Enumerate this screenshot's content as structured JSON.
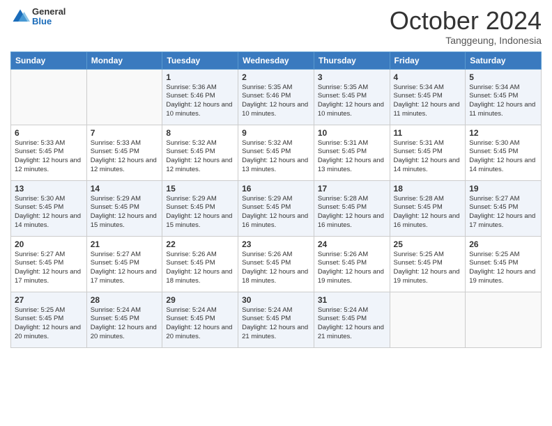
{
  "logo": {
    "general": "General",
    "blue": "Blue"
  },
  "header": {
    "month": "October 2024",
    "location": "Tanggeung, Indonesia"
  },
  "weekdays": [
    "Sunday",
    "Monday",
    "Tuesday",
    "Wednesday",
    "Thursday",
    "Friday",
    "Saturday"
  ],
  "weeks": [
    [
      {
        "day": "",
        "sunrise": "",
        "sunset": "",
        "daylight": ""
      },
      {
        "day": "",
        "sunrise": "",
        "sunset": "",
        "daylight": ""
      },
      {
        "day": "1",
        "sunrise": "Sunrise: 5:36 AM",
        "sunset": "Sunset: 5:46 PM",
        "daylight": "Daylight: 12 hours and 10 minutes."
      },
      {
        "day": "2",
        "sunrise": "Sunrise: 5:35 AM",
        "sunset": "Sunset: 5:46 PM",
        "daylight": "Daylight: 12 hours and 10 minutes."
      },
      {
        "day": "3",
        "sunrise": "Sunrise: 5:35 AM",
        "sunset": "Sunset: 5:45 PM",
        "daylight": "Daylight: 12 hours and 10 minutes."
      },
      {
        "day": "4",
        "sunrise": "Sunrise: 5:34 AM",
        "sunset": "Sunset: 5:45 PM",
        "daylight": "Daylight: 12 hours and 11 minutes."
      },
      {
        "day": "5",
        "sunrise": "Sunrise: 5:34 AM",
        "sunset": "Sunset: 5:45 PM",
        "daylight": "Daylight: 12 hours and 11 minutes."
      }
    ],
    [
      {
        "day": "6",
        "sunrise": "Sunrise: 5:33 AM",
        "sunset": "Sunset: 5:45 PM",
        "daylight": "Daylight: 12 hours and 12 minutes."
      },
      {
        "day": "7",
        "sunrise": "Sunrise: 5:33 AM",
        "sunset": "Sunset: 5:45 PM",
        "daylight": "Daylight: 12 hours and 12 minutes."
      },
      {
        "day": "8",
        "sunrise": "Sunrise: 5:32 AM",
        "sunset": "Sunset: 5:45 PM",
        "daylight": "Daylight: 12 hours and 12 minutes."
      },
      {
        "day": "9",
        "sunrise": "Sunrise: 5:32 AM",
        "sunset": "Sunset: 5:45 PM",
        "daylight": "Daylight: 12 hours and 13 minutes."
      },
      {
        "day": "10",
        "sunrise": "Sunrise: 5:31 AM",
        "sunset": "Sunset: 5:45 PM",
        "daylight": "Daylight: 12 hours and 13 minutes."
      },
      {
        "day": "11",
        "sunrise": "Sunrise: 5:31 AM",
        "sunset": "Sunset: 5:45 PM",
        "daylight": "Daylight: 12 hours and 14 minutes."
      },
      {
        "day": "12",
        "sunrise": "Sunrise: 5:30 AM",
        "sunset": "Sunset: 5:45 PM",
        "daylight": "Daylight: 12 hours and 14 minutes."
      }
    ],
    [
      {
        "day": "13",
        "sunrise": "Sunrise: 5:30 AM",
        "sunset": "Sunset: 5:45 PM",
        "daylight": "Daylight: 12 hours and 14 minutes."
      },
      {
        "day": "14",
        "sunrise": "Sunrise: 5:29 AM",
        "sunset": "Sunset: 5:45 PM",
        "daylight": "Daylight: 12 hours and 15 minutes."
      },
      {
        "day": "15",
        "sunrise": "Sunrise: 5:29 AM",
        "sunset": "Sunset: 5:45 PM",
        "daylight": "Daylight: 12 hours and 15 minutes."
      },
      {
        "day": "16",
        "sunrise": "Sunrise: 5:29 AM",
        "sunset": "Sunset: 5:45 PM",
        "daylight": "Daylight: 12 hours and 16 minutes."
      },
      {
        "day": "17",
        "sunrise": "Sunrise: 5:28 AM",
        "sunset": "Sunset: 5:45 PM",
        "daylight": "Daylight: 12 hours and 16 minutes."
      },
      {
        "day": "18",
        "sunrise": "Sunrise: 5:28 AM",
        "sunset": "Sunset: 5:45 PM",
        "daylight": "Daylight: 12 hours and 16 minutes."
      },
      {
        "day": "19",
        "sunrise": "Sunrise: 5:27 AM",
        "sunset": "Sunset: 5:45 PM",
        "daylight": "Daylight: 12 hours and 17 minutes."
      }
    ],
    [
      {
        "day": "20",
        "sunrise": "Sunrise: 5:27 AM",
        "sunset": "Sunset: 5:45 PM",
        "daylight": "Daylight: 12 hours and 17 minutes."
      },
      {
        "day": "21",
        "sunrise": "Sunrise: 5:27 AM",
        "sunset": "Sunset: 5:45 PM",
        "daylight": "Daylight: 12 hours and 17 minutes."
      },
      {
        "day": "22",
        "sunrise": "Sunrise: 5:26 AM",
        "sunset": "Sunset: 5:45 PM",
        "daylight": "Daylight: 12 hours and 18 minutes."
      },
      {
        "day": "23",
        "sunrise": "Sunrise: 5:26 AM",
        "sunset": "Sunset: 5:45 PM",
        "daylight": "Daylight: 12 hours and 18 minutes."
      },
      {
        "day": "24",
        "sunrise": "Sunrise: 5:26 AM",
        "sunset": "Sunset: 5:45 PM",
        "daylight": "Daylight: 12 hours and 19 minutes."
      },
      {
        "day": "25",
        "sunrise": "Sunrise: 5:25 AM",
        "sunset": "Sunset: 5:45 PM",
        "daylight": "Daylight: 12 hours and 19 minutes."
      },
      {
        "day": "26",
        "sunrise": "Sunrise: 5:25 AM",
        "sunset": "Sunset: 5:45 PM",
        "daylight": "Daylight: 12 hours and 19 minutes."
      }
    ],
    [
      {
        "day": "27",
        "sunrise": "Sunrise: 5:25 AM",
        "sunset": "Sunset: 5:45 PM",
        "daylight": "Daylight: 12 hours and 20 minutes."
      },
      {
        "day": "28",
        "sunrise": "Sunrise: 5:24 AM",
        "sunset": "Sunset: 5:45 PM",
        "daylight": "Daylight: 12 hours and 20 minutes."
      },
      {
        "day": "29",
        "sunrise": "Sunrise: 5:24 AM",
        "sunset": "Sunset: 5:45 PM",
        "daylight": "Daylight: 12 hours and 20 minutes."
      },
      {
        "day": "30",
        "sunrise": "Sunrise: 5:24 AM",
        "sunset": "Sunset: 5:45 PM",
        "daylight": "Daylight: 12 hours and 21 minutes."
      },
      {
        "day": "31",
        "sunrise": "Sunrise: 5:24 AM",
        "sunset": "Sunset: 5:45 PM",
        "daylight": "Daylight: 12 hours and 21 minutes."
      },
      {
        "day": "",
        "sunrise": "",
        "sunset": "",
        "daylight": ""
      },
      {
        "day": "",
        "sunrise": "",
        "sunset": "",
        "daylight": ""
      }
    ]
  ]
}
